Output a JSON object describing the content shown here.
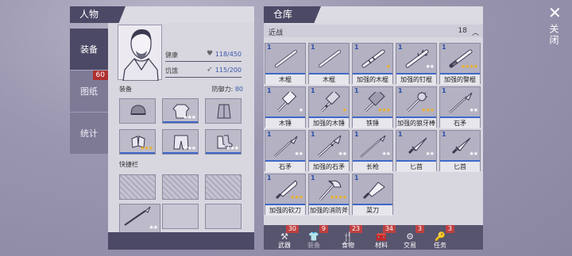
{
  "left_panel": {
    "title": "人物",
    "tabs": [
      {
        "label": "装备",
        "badge": ""
      },
      {
        "label": "图纸",
        "badge": "60"
      },
      {
        "label": "统计",
        "badge": ""
      }
    ],
    "stats": {
      "health_label": "健康",
      "health_value": "118/450",
      "hunger_label": "饥饿",
      "hunger_value": "115/200"
    },
    "equipment_label": "装备",
    "defense_label": "防御力:",
    "defense_value": "80",
    "equipment_slots": [
      {
        "icon": "helmet-icon",
        "stars": ""
      },
      {
        "icon": "jacket-icon",
        "stars": "★★★"
      },
      {
        "icon": "armor-vest-icon",
        "stars": ""
      },
      {
        "icon": "gloves-icon",
        "stars": "★★★"
      },
      {
        "icon": "pants-icon",
        "stars": "★★★"
      },
      {
        "icon": "boots-icon",
        "stars": "★★★"
      }
    ],
    "quickbar_label": "快捷栏",
    "quickbar_slot5_stars": "★★"
  },
  "storage": {
    "title": "仓库",
    "section_label": "近战",
    "section_count": "18",
    "items": [
      {
        "qty": "1",
        "name": "木棍",
        "stars": "",
        "icon": "stick-icon"
      },
      {
        "qty": "1",
        "name": "木棍",
        "stars": "",
        "icon": "stick-icon"
      },
      {
        "qty": "1",
        "name": "加强的木棍",
        "stars": "★",
        "icon": "reinforced-stick-icon"
      },
      {
        "qty": "1",
        "name": "加强的钉棍",
        "stars": "★★",
        "icon": "nail-bat-icon"
      },
      {
        "qty": "1",
        "name": "加强的警棍",
        "stars": "★★★★",
        "icon": "baton-icon"
      },
      {
        "qty": "1",
        "name": "木锤",
        "stars": "★",
        "icon": "wooden-hammer-icon"
      },
      {
        "qty": "1",
        "name": "加强的木锤",
        "stars": "★",
        "icon": "reinforced-hammer-icon"
      },
      {
        "qty": "1",
        "name": "铁锤",
        "stars": "★★★",
        "icon": "iron-hammer-icon"
      },
      {
        "qty": "1",
        "name": "加强的狼牙棒",
        "stars": "★★★",
        "icon": "mace-icon"
      },
      {
        "qty": "1",
        "name": "石矛",
        "stars": "★★",
        "icon": "stone-spear-icon"
      },
      {
        "qty": "1",
        "name": "石矛",
        "stars": "★★",
        "icon": "stone-spear-icon"
      },
      {
        "qty": "1",
        "name": "加强的石矛",
        "stars": "★★",
        "icon": "reinforced-spear-icon"
      },
      {
        "qty": "1",
        "name": "长枪",
        "stars": "★★",
        "icon": "long-spear-icon"
      },
      {
        "qty": "1",
        "name": "匕首",
        "stars": "★★",
        "icon": "dagger-icon"
      },
      {
        "qty": "1",
        "name": "匕首",
        "stars": "★★",
        "icon": "dagger-icon"
      },
      {
        "qty": "1",
        "name": "加强的砍刀",
        "stars": "★★★",
        "icon": "machete-icon"
      },
      {
        "qty": "1",
        "name": "加强的消防斧",
        "stars": "★★★★",
        "icon": "fire-axe-icon"
      },
      {
        "qty": "1",
        "name": "菜刀",
        "stars": "",
        "icon": "kitchen-knife-icon"
      }
    ],
    "categories": [
      {
        "label": "武器",
        "count": "30",
        "icon": "weapon-icon"
      },
      {
        "label": "装备",
        "count": "9",
        "icon": "equipment-icon"
      },
      {
        "label": "食物",
        "count": "23",
        "icon": "food-icon"
      },
      {
        "label": "材料",
        "count": "34",
        "icon": "materials-icon"
      },
      {
        "label": "交易",
        "count": "3",
        "icon": "trade-icon"
      },
      {
        "label": "任务",
        "count": "3",
        "icon": "quest-icon"
      }
    ]
  },
  "close": {
    "label": "关闭"
  }
}
